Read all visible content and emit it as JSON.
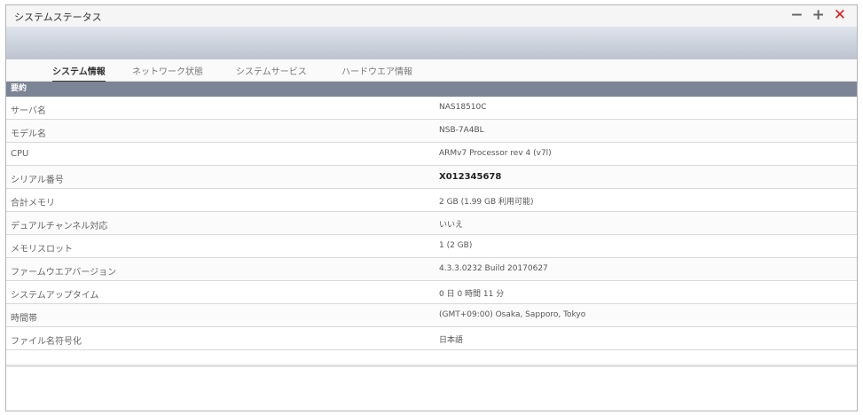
{
  "window": {
    "title": "システムステータス"
  },
  "controls": {
    "minimize": "−",
    "maximize": "+",
    "close": "✕"
  },
  "tabs": [
    {
      "label": "システム情報",
      "active": true
    },
    {
      "label": "ネットワーク状態",
      "active": false
    },
    {
      "label": "システムサービス",
      "active": false
    },
    {
      "label": "ハードウエア情報",
      "active": false
    }
  ],
  "section": {
    "title": "要約"
  },
  "rows": [
    {
      "label": "サーバ名",
      "value": "NAS18510C"
    },
    {
      "label": "モデル名",
      "value": "NSB-7A4BL"
    },
    {
      "label": "CPU",
      "value": "ARMv7 Processor rev 4 (v7l)"
    },
    {
      "label": "シリアル番号",
      "value": "X012345678"
    },
    {
      "label": "合計メモリ",
      "value": "2 GB (1.99 GB 利用可能)"
    },
    {
      "label": "デュアルチャンネル対応",
      "value": "いいえ"
    },
    {
      "label": "メモリスロット",
      "value": "1 (2 GB)"
    },
    {
      "label": "ファームウエアバージョン",
      "value": "4.3.3.0232 Build 20170627"
    },
    {
      "label": "システムアップタイム",
      "value": "0 日 0 時間 11 分"
    },
    {
      "label": "時間帯",
      "value": "(GMT+09:00) Osaka, Sapporo, Tokyo"
    },
    {
      "label": "ファイル名符号化",
      "value": "日本語"
    }
  ]
}
